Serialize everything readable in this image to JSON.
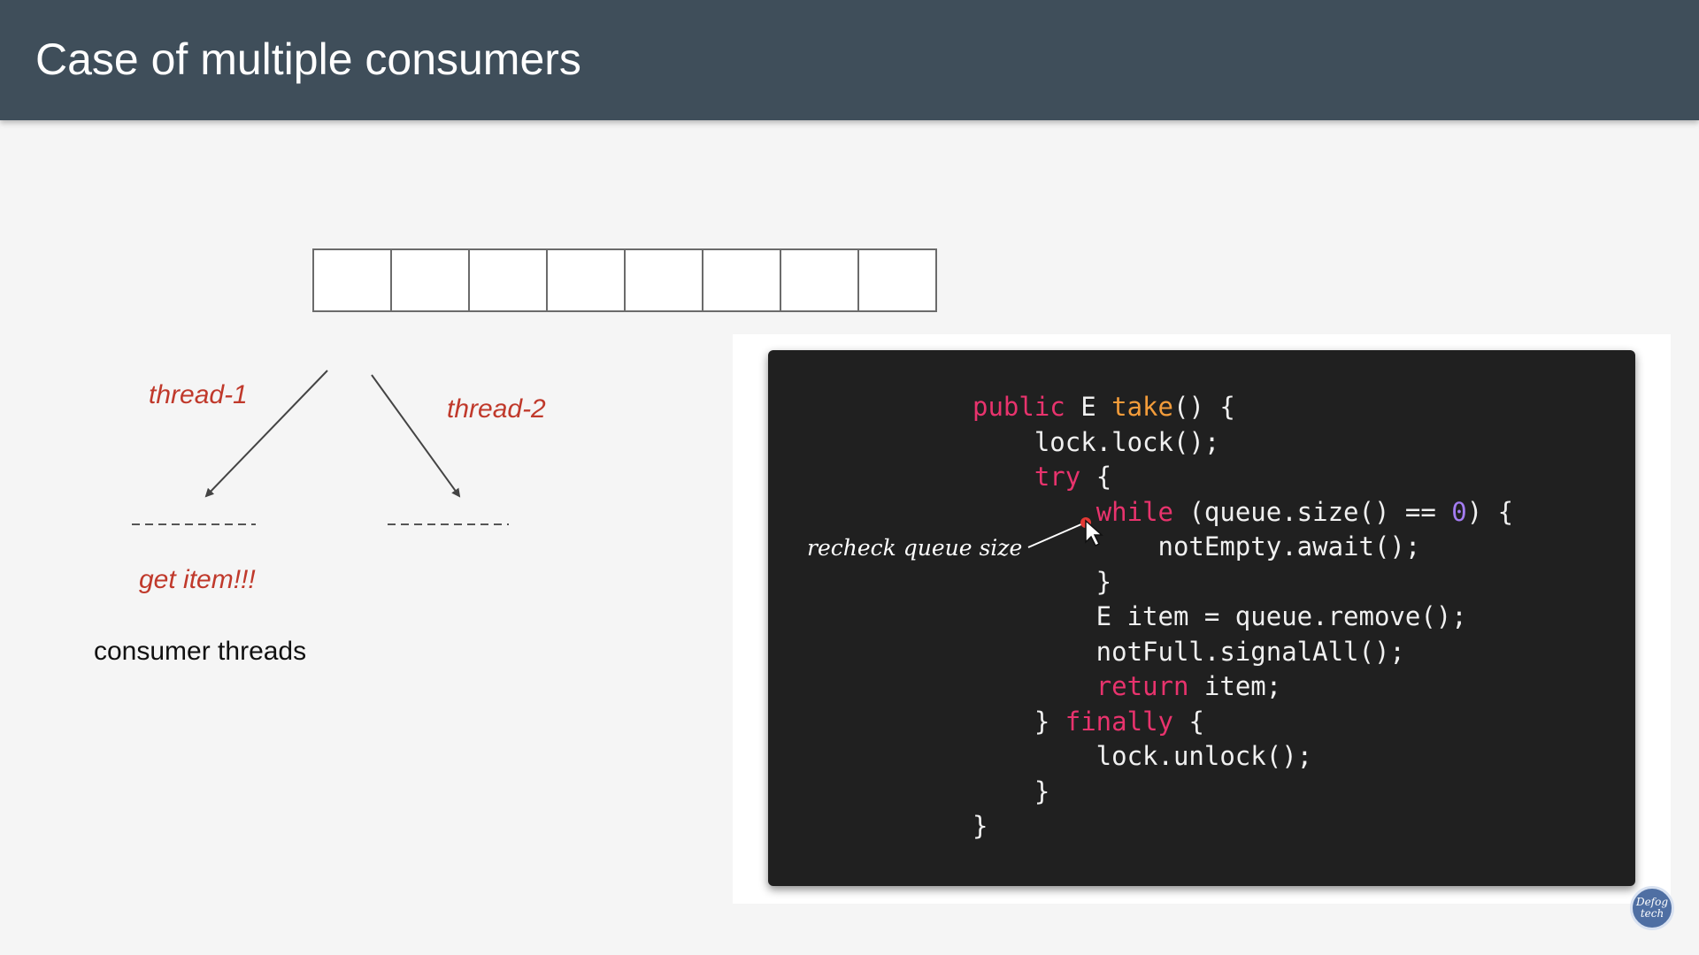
{
  "header": {
    "title": "Case of multiple consumers"
  },
  "queue": {
    "slot_count": 8
  },
  "threads": [
    {
      "label": "thread-1"
    },
    {
      "label": "thread-2"
    }
  ],
  "get_item_label": "get item!!!",
  "consumer_caption": "consumer threads",
  "annotation": "recheck queue size",
  "logo": {
    "text": "Defog tech"
  },
  "code": {
    "lines": [
      [
        {
          "t": "public ",
          "c": "kw"
        },
        {
          "t": "E "
        },
        {
          "t": "take",
          "c": "fn"
        },
        {
          "t": "() {"
        }
      ],
      [
        {
          "t": "    lock.lock();"
        }
      ],
      [
        {
          "t": "    "
        },
        {
          "t": "try",
          "c": "kw"
        },
        {
          "t": " {"
        }
      ],
      [
        {
          "t": "        "
        },
        {
          "t": "while",
          "c": "kw"
        },
        {
          "t": " (queue.size() == "
        },
        {
          "t": "0",
          "c": "num"
        },
        {
          "t": ") {"
        }
      ],
      [
        {
          "t": "            notEmpty.await();"
        }
      ],
      [
        {
          "t": "        }"
        }
      ],
      [
        {
          "t": "        E item = queue.remove();"
        }
      ],
      [
        {
          "t": "        notFull.signalAll();"
        }
      ],
      [
        {
          "t": "        "
        },
        {
          "t": "return",
          "c": "kw"
        },
        {
          "t": " item;"
        }
      ],
      [
        {
          "t": "    } "
        },
        {
          "t": "finally",
          "c": "kw"
        },
        {
          "t": " {"
        }
      ],
      [
        {
          "t": "        lock.unlock();"
        }
      ],
      [
        {
          "t": "    }"
        }
      ],
      [
        {
          "t": "}"
        }
      ]
    ]
  },
  "colors": {
    "header_bg": "#3f4e5a",
    "label_red": "#c0392b",
    "keyword": "#e8336d",
    "function": "#f39c3a",
    "number": "#a47cf2",
    "code_bg": "#202020",
    "cursor_dot": "#e53935"
  }
}
